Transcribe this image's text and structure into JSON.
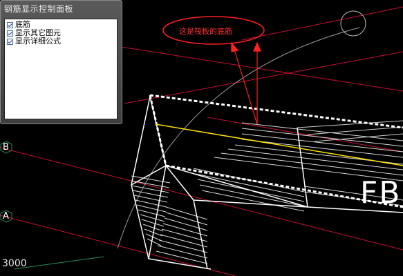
{
  "panel": {
    "title": "钢筋显示控制面板",
    "options": [
      {
        "label": "底筋",
        "checked": true
      },
      {
        "label": "显示其它图元",
        "checked": true
      },
      {
        "label": "显示详细公式",
        "checked": true
      }
    ]
  },
  "annotation": {
    "text": "这是筏板的底筋",
    "color": "#ff2020"
  },
  "axes": {
    "b": "B",
    "a": "A"
  },
  "coordinate": "3000",
  "beam_tag": "FB",
  "colors": {
    "grid": "#c8102e",
    "rebar": "#d9d9d9",
    "highlight": "#ffe600",
    "axis_circle": "#2e8b57",
    "background": "#000000"
  }
}
